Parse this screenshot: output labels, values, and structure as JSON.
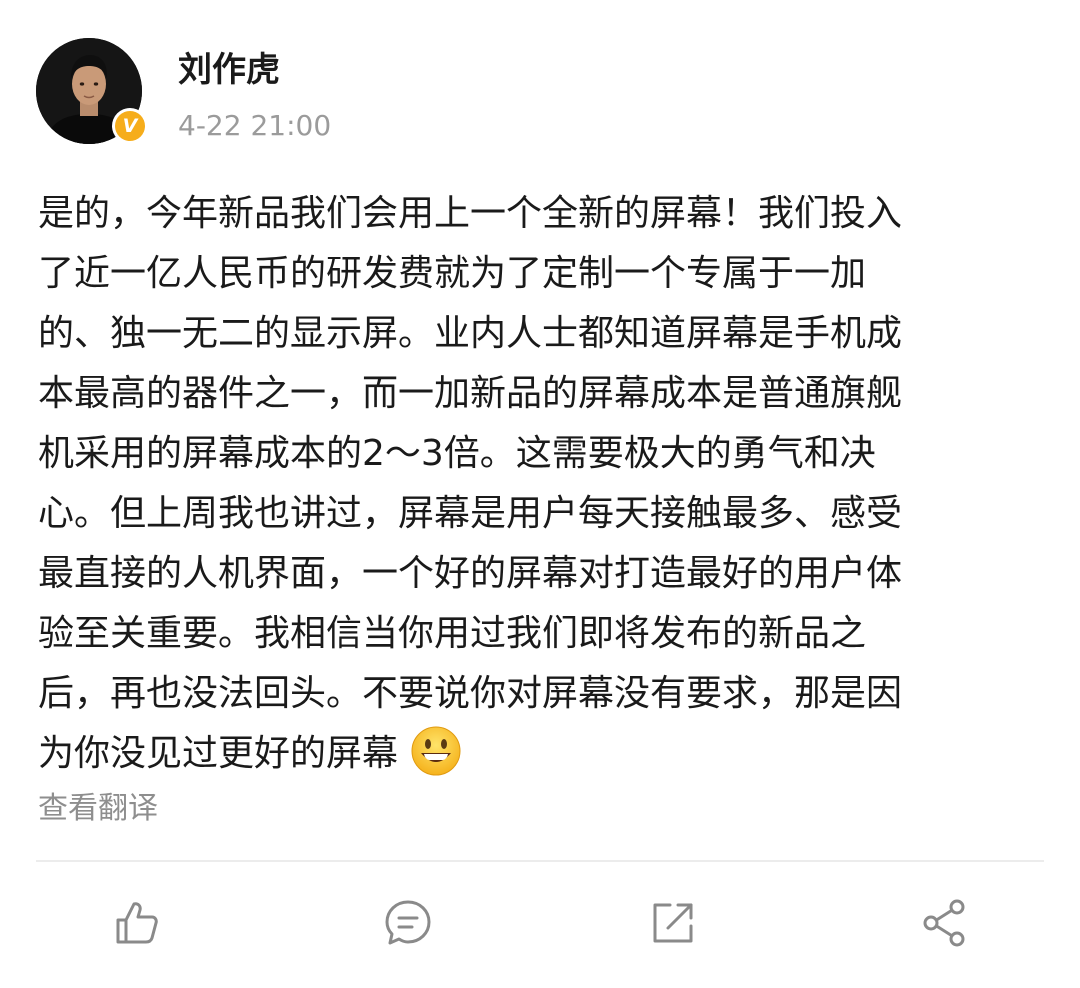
{
  "post": {
    "author": {
      "name": "刘作虎",
      "verified_badge": "V",
      "badge_color": "#f6ad1b"
    },
    "timestamp": "4-22 21:00",
    "body_lines": [
      "是的，今年新品我们会用上一个全新的屏幕！我们投入",
      "了近一亿人民币的研发费就为了定制一个专属于一加",
      "的、独一无二的显示屏。业内人士都知道屏幕是手机成",
      "本最高的器件之一，而一加新品的屏幕成本是普通旗舰",
      "机采用的屏幕成本的2～3倍。这需要极大的勇气和决",
      "心。但上周我也讲过，屏幕是用户每天接触最多、感受",
      "最直接的人机界面，一个好的屏幕对打造最好的用户体",
      "验至关重要。我相信当你用过我们即将发布的新品之",
      "后，再也没法回头。不要说你对屏幕没有要求，那是因",
      "为你没见过更好的屏幕"
    ],
    "emoji": "grinning-face",
    "translate_label": "查看翻译"
  },
  "actions": [
    {
      "icon": "thumbs-up-icon"
    },
    {
      "icon": "comment-icon"
    },
    {
      "icon": "repost-icon"
    },
    {
      "icon": "share-icon"
    }
  ],
  "colors": {
    "text": "#1a1a1a",
    "secondary_text": "#9b9b9b",
    "icon": "#8a8a8a",
    "divider": "#ececec"
  }
}
